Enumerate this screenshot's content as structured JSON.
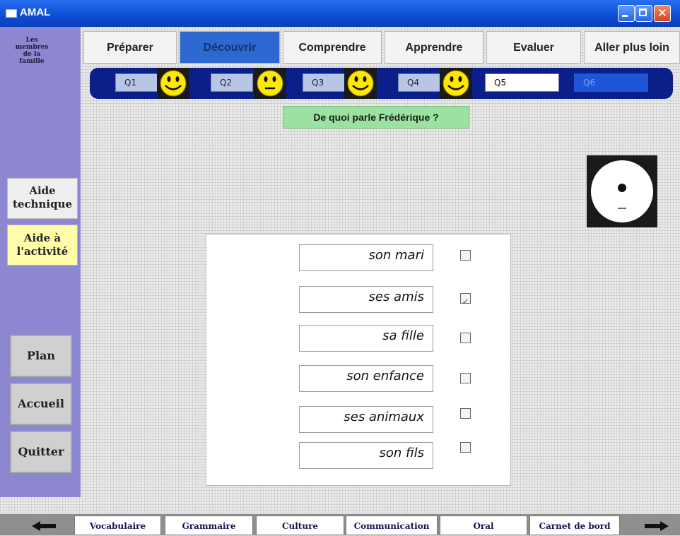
{
  "window": {
    "title": "AMAL"
  },
  "sidebar": {
    "topic": [
      "Les",
      "membres",
      "de la",
      "famille"
    ],
    "help_tech": [
      "Aide",
      "technique"
    ],
    "help_activity": [
      "Aide à",
      "l'activité"
    ],
    "nav": [
      "Plan",
      "Accueil",
      "Quitter"
    ]
  },
  "tabs": [
    "Préparer",
    "Découvrir",
    "Comprendre",
    "Apprendre",
    "Evaluer",
    "Aller plus loin"
  ],
  "active_tab": "Découvrir",
  "questions": [
    {
      "label": "Q1",
      "state": "done"
    },
    {
      "label": "Q2",
      "state": "done"
    },
    {
      "label": "Q3",
      "state": "done"
    },
    {
      "label": "Q4",
      "state": "done"
    },
    {
      "label": "Q5",
      "state": "current"
    },
    {
      "label": "Q6",
      "state": "future"
    }
  ],
  "prompt": "De quoi parle Frédérique ?",
  "answers": [
    {
      "text": "son mari",
      "checked": false
    },
    {
      "text": "ses amis",
      "checked": true
    },
    {
      "text": "sa fille",
      "checked": false
    },
    {
      "text": "son enfance",
      "checked": false
    },
    {
      "text": "ses animaux",
      "checked": false
    },
    {
      "text": "son fils",
      "checked": false
    }
  ],
  "bottom_tabs": [
    "Vocabulaire",
    "Grammaire",
    "Culture",
    "Communication",
    "Oral",
    "Carnet de bord"
  ],
  "colors": {
    "title_bar": "#0e4fd6",
    "sidebar": "#8c87d0",
    "active_tab": "#2c68d0",
    "question_bg": "#9be2a1",
    "activity_help": "#fffcaa"
  }
}
